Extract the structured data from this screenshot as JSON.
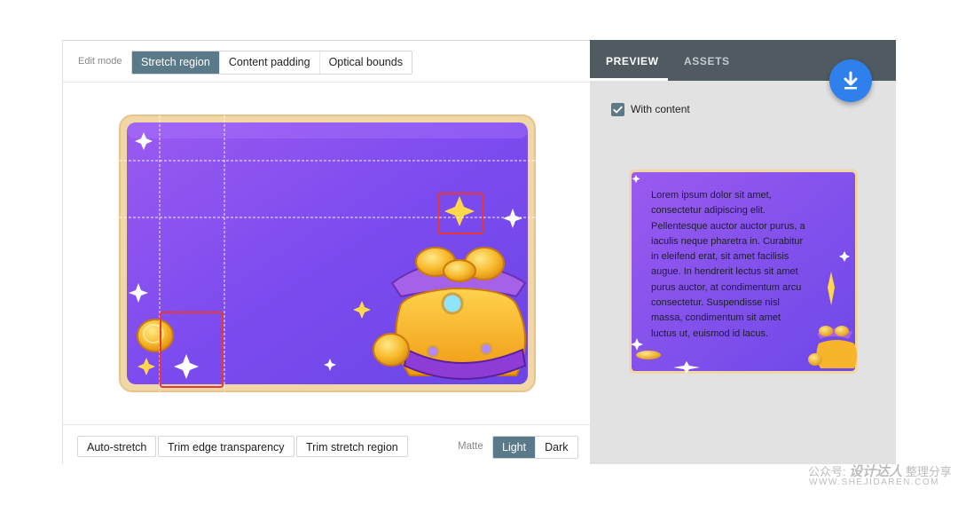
{
  "editor": {
    "mode_label": "Edit mode",
    "modes": [
      {
        "label": "Stretch region",
        "active": true
      },
      {
        "label": "Content padding",
        "active": false
      },
      {
        "label": "Optical bounds",
        "active": false
      }
    ],
    "bottom_actions": {
      "auto_stretch": "Auto-stretch",
      "trim_edge": "Trim edge transparency",
      "trim_stretch": "Trim stretch region"
    },
    "matte": {
      "label": "Matte",
      "options": [
        {
          "label": "Light",
          "active": true
        },
        {
          "label": "Dark",
          "active": false
        }
      ]
    }
  },
  "preview": {
    "tabs": [
      {
        "label": "PREVIEW",
        "active": true
      },
      {
        "label": "ASSETS",
        "active": false
      }
    ],
    "with_content": {
      "label": "With content",
      "checked": true
    },
    "content_text": "Lorem ipsum dolor sit amet, consectetur adipiscing elit. Pellentesque auctor auctor purus, a iaculis neque pharetra in. Curabitur in eleifend erat, sit amet facilisis augue. In hendrerit lectus sit amet purus auctor, at condimentum arcu consectetur. Suspendisse nisl massa, condimentum sit amet luctus ut, euismod id lacus."
  },
  "icons": {
    "download": "download-icon",
    "check": "check-icon"
  },
  "colors": {
    "accent": "#5b7a89",
    "tab_bar": "#4f5a61",
    "fab": "#2f80ed",
    "highlight_box": "#e53935"
  },
  "watermark": {
    "line1_prefix": "公众号:",
    "line1_brand": "设计达人",
    "line1_suffix": "整理分享",
    "line2": "WWW.SHEJIDAREN.COM"
  }
}
